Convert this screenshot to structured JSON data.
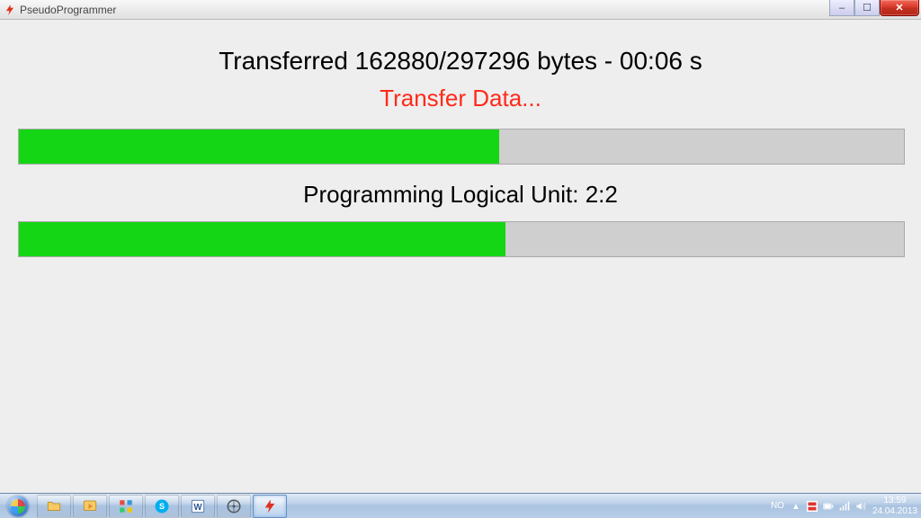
{
  "window": {
    "title": "PseudoProgrammer"
  },
  "main": {
    "transfer_line": "Transferred 162880/297296 bytes - 00:06 s",
    "status_line": "Transfer Data...",
    "logical_line": "Programming Logical Unit: 2:2",
    "progress1_percent": 54.3,
    "progress2_percent": 55.0
  },
  "taskbar": {
    "language": "NO",
    "time": "13:59",
    "date": "24.04.2013"
  }
}
